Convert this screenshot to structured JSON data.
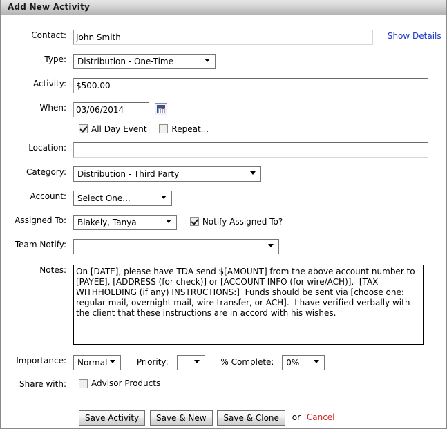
{
  "window": {
    "title": "Add New Activity"
  },
  "form": {
    "contact": {
      "label": "Contact:",
      "value": "John Smith",
      "show_details_link": "Show Details"
    },
    "type": {
      "label": "Type:",
      "value": "Distribution - One-Time"
    },
    "activity": {
      "label": "Activity:",
      "value": "$500.00"
    },
    "when": {
      "label": "When:",
      "value": "03/06/2014",
      "calendar_icon": "calendar-icon",
      "all_day_label": "All Day Event",
      "all_day_checked": true,
      "repeat_label": "Repeat...",
      "repeat_checked": false
    },
    "location": {
      "label": "Location:",
      "value": ""
    },
    "category": {
      "label": "Category:",
      "value": "Distribution - Third Party"
    },
    "account": {
      "label": "Account:",
      "value": "Select One..."
    },
    "assigned_to": {
      "label": "Assigned To:",
      "value": "Blakely, Tanya",
      "notify_label": "Notify Assigned To?",
      "notify_checked": true
    },
    "team_notify": {
      "label": "Team Notify:",
      "value": ""
    },
    "notes": {
      "label": "Notes:",
      "value": "On [DATE], please have TDA send $[AMOUNT] from the above account number to [PAYEE], [ADDRESS (for check)] or [ACCOUNT INFO (for wire/ACH)].  [TAX WITHHOLDING (if any) INSTRUCTIONS:]  Funds should be sent via [choose one: regular mail, overnight mail, wire transfer, or ACH].  I have verified verbally with the client that these instructions are in accord with his wishes."
    },
    "importance": {
      "label": "Importance:",
      "value": "Normal"
    },
    "priority": {
      "label": "Priority:",
      "value": ""
    },
    "percent_complete": {
      "label": "% Complete:",
      "value": "0%"
    },
    "share_with": {
      "label": "Share with:",
      "option_label": "Advisor Products",
      "checked": false
    }
  },
  "actions": {
    "save_activity": "Save Activity",
    "save_and_new": "Save & New",
    "save_and_clone": "Save & Clone",
    "or_text": "or",
    "cancel": "Cancel"
  },
  "colors": {
    "link_blue": "#1b35c8",
    "link_red": "#d81f1f",
    "titlebar_top": "#e6e6e6",
    "titlebar_bottom": "#b4b4b4"
  }
}
